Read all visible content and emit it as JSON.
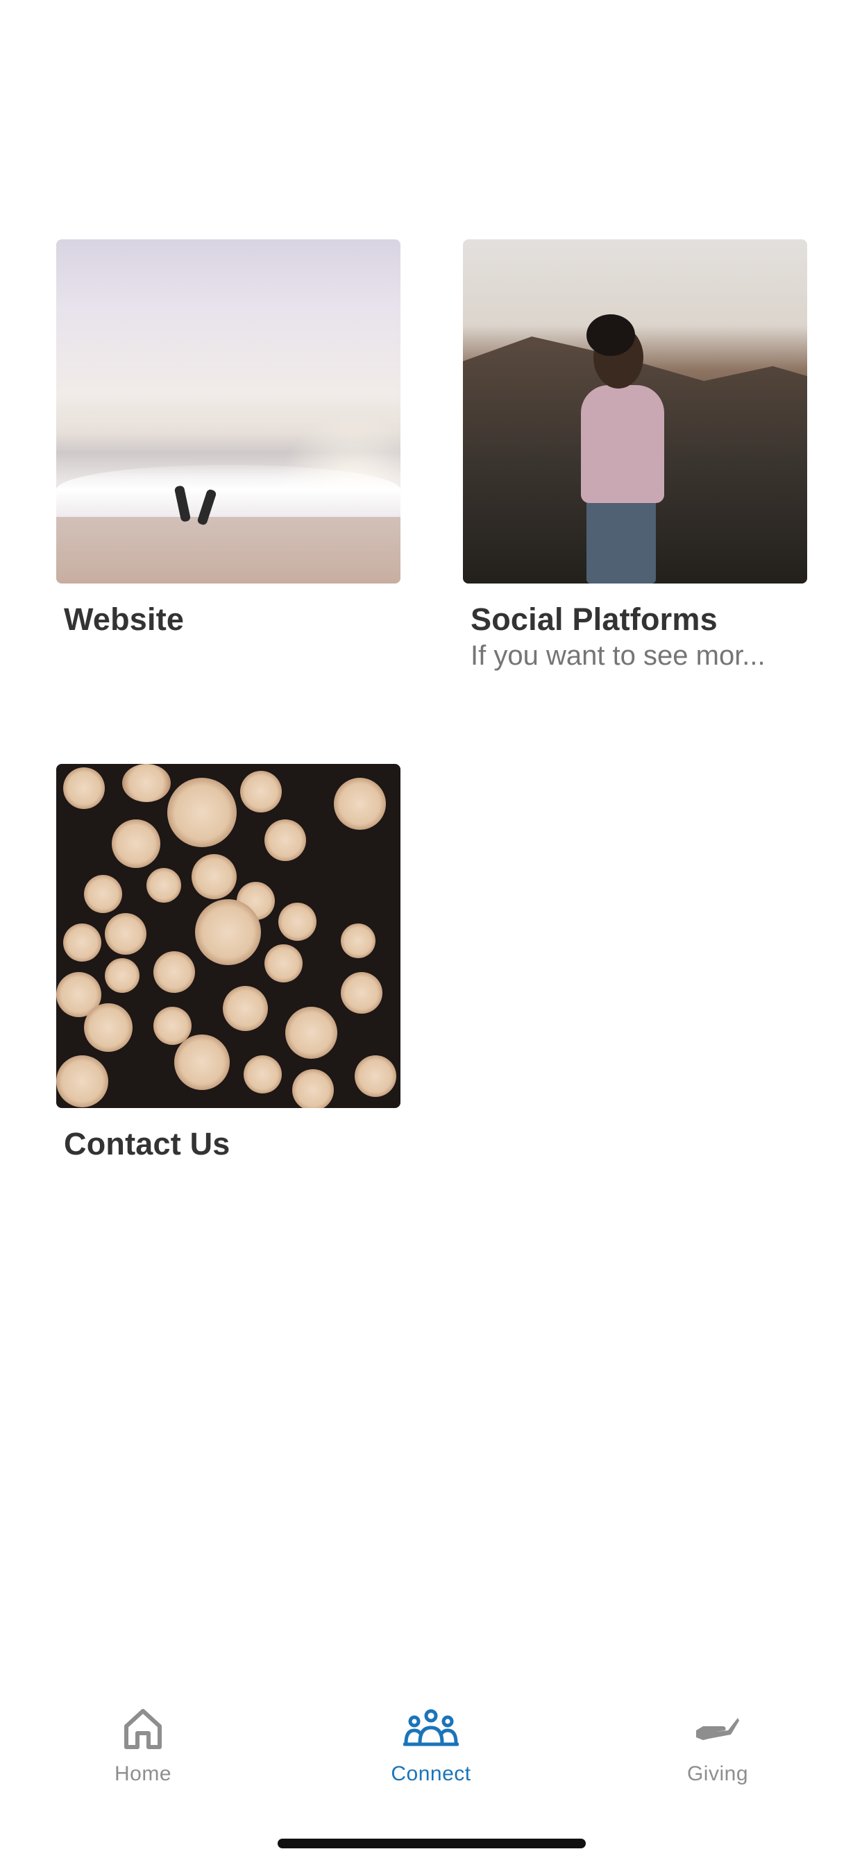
{
  "cards": [
    {
      "title": "Website",
      "subtitle": ""
    },
    {
      "title": "Social Platforms",
      "subtitle": "If you want to see mor..."
    },
    {
      "title": "Contact Us",
      "subtitle": ""
    }
  ],
  "tabbar": {
    "items": [
      {
        "label": "Home",
        "icon": "home-icon",
        "active": false
      },
      {
        "label": "Connect",
        "icon": "people-group-icon",
        "active": true
      },
      {
        "label": "Giving",
        "icon": "giving-hand-icon",
        "active": false
      }
    ],
    "active_color": "#1a74b9",
    "inactive_color": "#8e8e8e"
  }
}
